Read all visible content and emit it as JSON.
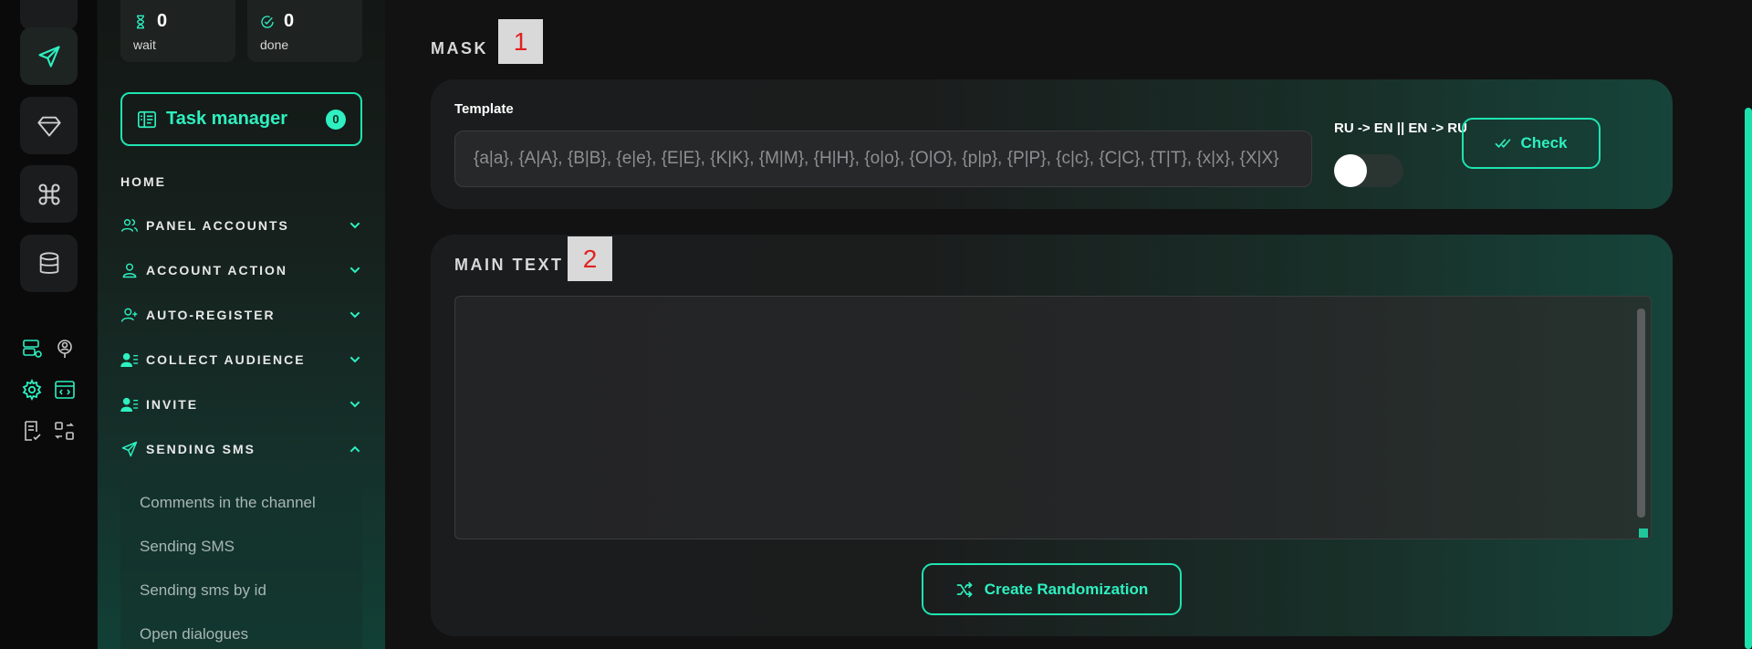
{
  "stats": {
    "wait": {
      "value": "0",
      "label": "wait"
    },
    "done": {
      "value": "0",
      "label": "done"
    }
  },
  "task_manager": {
    "label": "Task manager",
    "count": "0"
  },
  "nav": {
    "home": "HOME",
    "items": [
      {
        "label": "PANEL ACCOUNTS",
        "icon": "users-icon",
        "expanded": false
      },
      {
        "label": "ACCOUNT ACTION",
        "icon": "user-icon",
        "expanded": false
      },
      {
        "label": "AUTO-REGISTER",
        "icon": "user-plus-icon",
        "expanded": false
      },
      {
        "label": "COLLECT AUDIENCE",
        "icon": "user-list-icon",
        "expanded": false
      },
      {
        "label": "INVITE",
        "icon": "user-list-icon",
        "expanded": false
      },
      {
        "label": "SENDING SMS",
        "icon": "send-icon",
        "expanded": true
      }
    ],
    "sub_items": [
      "Comments in the channel",
      "Sending SMS",
      "Sending sms by id",
      "Open dialogues"
    ]
  },
  "mask": {
    "title": "MASK",
    "marker": "1",
    "template_label": "Template",
    "template_placeholder": "{a|a}, {A|A}, {B|B}, {e|e}, {E|E}, {K|K}, {M|M}, {H|H}, {o|o}, {O|O}, {p|p}, {P|P}, {c|c}, {C|C}, {T|T}, {x|x}, {X|X}",
    "toggle_label": "RU -> EN || EN -> RU",
    "toggle_on": false,
    "check_label": "Check"
  },
  "main_text": {
    "title": "MAIN TEXT",
    "marker": "2",
    "value": "",
    "randomize_label": "Create Randomization"
  },
  "colors": {
    "accent": "#2ef0c0",
    "accent_border": "#1fe3b1",
    "marker_text": "#e12222"
  }
}
